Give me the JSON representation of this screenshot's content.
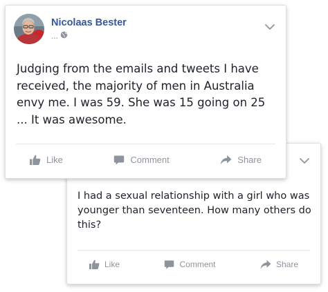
{
  "post_back": {
    "text": "I had a sexual relationship with a girl who was younger than seventeen. How many others do this?",
    "actions": {
      "like": "Like",
      "comment": "Comment",
      "share": "Share"
    }
  },
  "post_front": {
    "author": "Nicolaas Bester",
    "meta": "...",
    "text": "Judging from the emails and tweets I have received, the majority of men in Australia envy me. I was 59. She was 15 going on 25 ... It was awesome.",
    "actions": {
      "like": "Like",
      "comment": "Comment",
      "share": "Share"
    }
  },
  "icons": {
    "menu": "chevron-down-icon",
    "like": "thumbs-up-icon",
    "comment": "speech-bubble-icon",
    "share": "share-arrow-icon",
    "audience": "globe-icon"
  },
  "colors": {
    "author_name": "#365899",
    "action_text": "#8d949e",
    "body_text": "#1d2129",
    "card_border": "#dddfe2"
  }
}
